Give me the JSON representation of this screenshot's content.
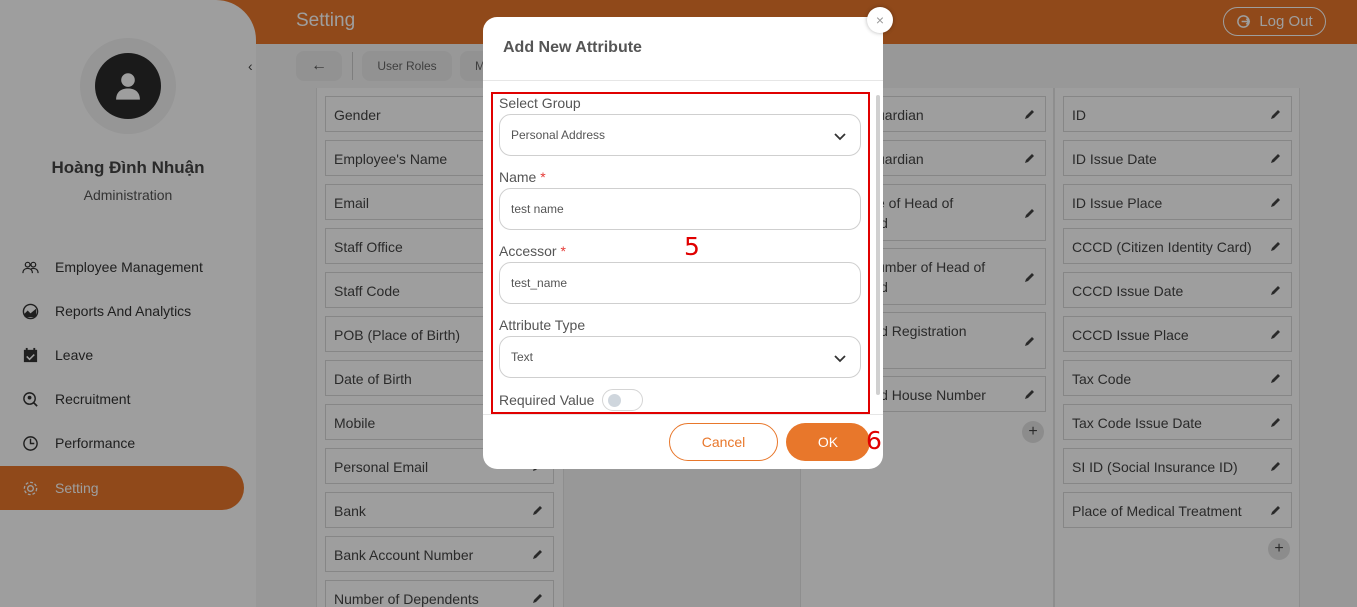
{
  "header": {
    "title": "Setting",
    "logout_label": "Log Out"
  },
  "user": {
    "name": "Hoàng Đình Nhuận",
    "role": "Administration"
  },
  "sidebar": {
    "collapse_icon": "‹",
    "items": [
      {
        "label": "Employee Management",
        "icon": "people-icon"
      },
      {
        "label": "Reports And Analytics",
        "icon": "chart-icon"
      },
      {
        "label": "Leave",
        "icon": "calendar-icon"
      },
      {
        "label": "Recruitment",
        "icon": "recruit-icon"
      },
      {
        "label": "Performance",
        "icon": "performance-icon"
      },
      {
        "label": "Setting",
        "icon": "gear-icon",
        "active": true
      }
    ]
  },
  "toolbar": {
    "back_icon": "←",
    "tabs": [
      "User Roles",
      "M"
    ]
  },
  "left_column": [
    "Gender",
    "Employee's Name",
    "Email",
    "Staff Office",
    "Staff Code",
    "POB (Place of Birth)",
    "Date of Birth",
    "Mobile",
    "Personal Email",
    "Bank",
    "Bank Account Number",
    "Number of Dependents"
  ],
  "middle_column": [
    "uardian",
    "uardian",
    "e of Head of\nld",
    "umber of Head of\nld",
    "ld Registration",
    "ld House Number"
  ],
  "right_column": [
    "ID",
    "ID Issue Date",
    "ID Issue Place",
    "CCCD (Citizen Identity Card)",
    "CCCD Issue Date",
    "CCCD Issue Place",
    "Tax Code",
    "Tax Code Issue Date",
    "SI ID (Social Insurance ID)",
    "Place of Medical Treatment"
  ],
  "modal": {
    "title": "Add New Attribute",
    "close_icon": "×",
    "select_group": {
      "label": "Select Group",
      "value": "Personal Address"
    },
    "name": {
      "label": "Name",
      "required_mark": "*",
      "value": "test name"
    },
    "accessor": {
      "label": "Accessor",
      "required_mark": "*",
      "value": "test_name"
    },
    "attribute_type": {
      "label": "Attribute Type",
      "value": "Text"
    },
    "required_value": {
      "label": "Required Value",
      "checked": false
    },
    "cancel_label": "Cancel",
    "ok_label": "OK"
  },
  "annotations": {
    "box_number": "5",
    "ok_number": "6"
  },
  "colors": {
    "accent": "#e8772b",
    "annotation": "#e00000"
  }
}
